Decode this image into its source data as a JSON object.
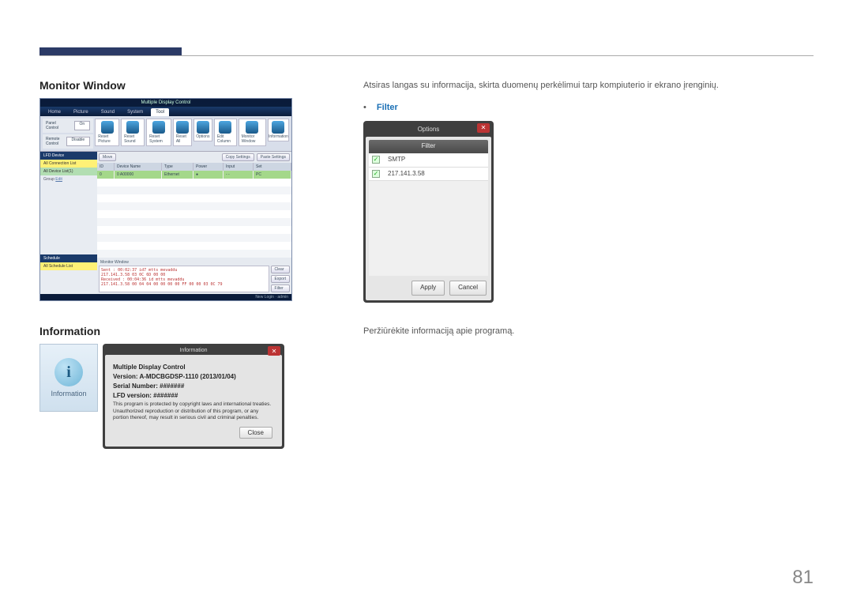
{
  "page_number": "81",
  "s1": {
    "title": "Monitor Window",
    "desc": "Atsiras langas su informacija, skirta duomenų perkėlimui tarp kompiuterio ir ekrano įrenginių.",
    "filter_label": "Filter"
  },
  "s2": {
    "title": "Information",
    "desc": "Peržiūrėkite informaciją apie programą."
  },
  "mdc": {
    "title": "Multiple Display Control",
    "tabs": {
      "home": "Home",
      "picture": "Picture",
      "sound": "Sound",
      "system": "System",
      "tool": "Tool"
    },
    "panel": {
      "panel_ctrl": "Panel Control",
      "panel_val": "On",
      "remote_ctrl": "Remote Control",
      "remote_val": "Disable"
    },
    "tools": {
      "reset_pic": "Reset Picture",
      "reset_snd": "Reset Sound",
      "reset_sys": "Reset System",
      "reset_all": "Reset All",
      "options": "Options",
      "edit_col": "Edit Column",
      "monitor": "Monitor Window",
      "info": "Information"
    },
    "btns": {
      "move": "Move",
      "copy": "Copy Settings",
      "paste": "Paste Settings"
    },
    "side": {
      "lfd": "LFD Device",
      "all_conn": "All Connection List",
      "all_dev": "All Device List(1)",
      "group": "Group",
      "edit": "Edit",
      "schedule": "Schedule",
      "all_sched": "All Schedule List"
    },
    "thead": {
      "id": "ID",
      "name": "Device Name",
      "type": "Type",
      "power": "Power",
      "input": "Input",
      "set": "Set"
    },
    "row": {
      "id": "0",
      "name": "0 A00000",
      "type": "Ethernet",
      "power": "●",
      "input": "- -",
      "set": "PC"
    },
    "monwin": "Monitor Window",
    "mon_l1": "Sent : 00:02:37 id7 mtts mevaddu",
    "mon_l2": "217.141.3.58 03 0C 6D 00 00",
    "mon_l3": "Received : 00:04:36 id mtts mevaddu",
    "mon_l4": "217.141.3.58 00 04 04 00 00 00 00 FF 00 00 03 0C 79",
    "mbtn": {
      "clear": "Clear",
      "export": "Export",
      "filter": "Filter"
    },
    "footer": "New Login · admin"
  },
  "opt": {
    "title": "Options",
    "filter": "Filter",
    "rows": [
      "SMTP",
      "217.141.3.58"
    ],
    "apply": "Apply",
    "cancel": "Cancel"
  },
  "info": {
    "icon_label": "Information",
    "dlg_title": "Information",
    "p1": "Multiple Display Control",
    "p2": "Version: A-MDCBGDSP-1110 (2013/01/04)",
    "p3": "Serial Number: #######",
    "p4": "LFD version: #######",
    "p5": "This program is protected by copyright laws and international treaties. Unauthorized reproduction or distribution of this program, or any portion thereof, may result in serious civil and criminal penalties.",
    "close": "Close"
  }
}
